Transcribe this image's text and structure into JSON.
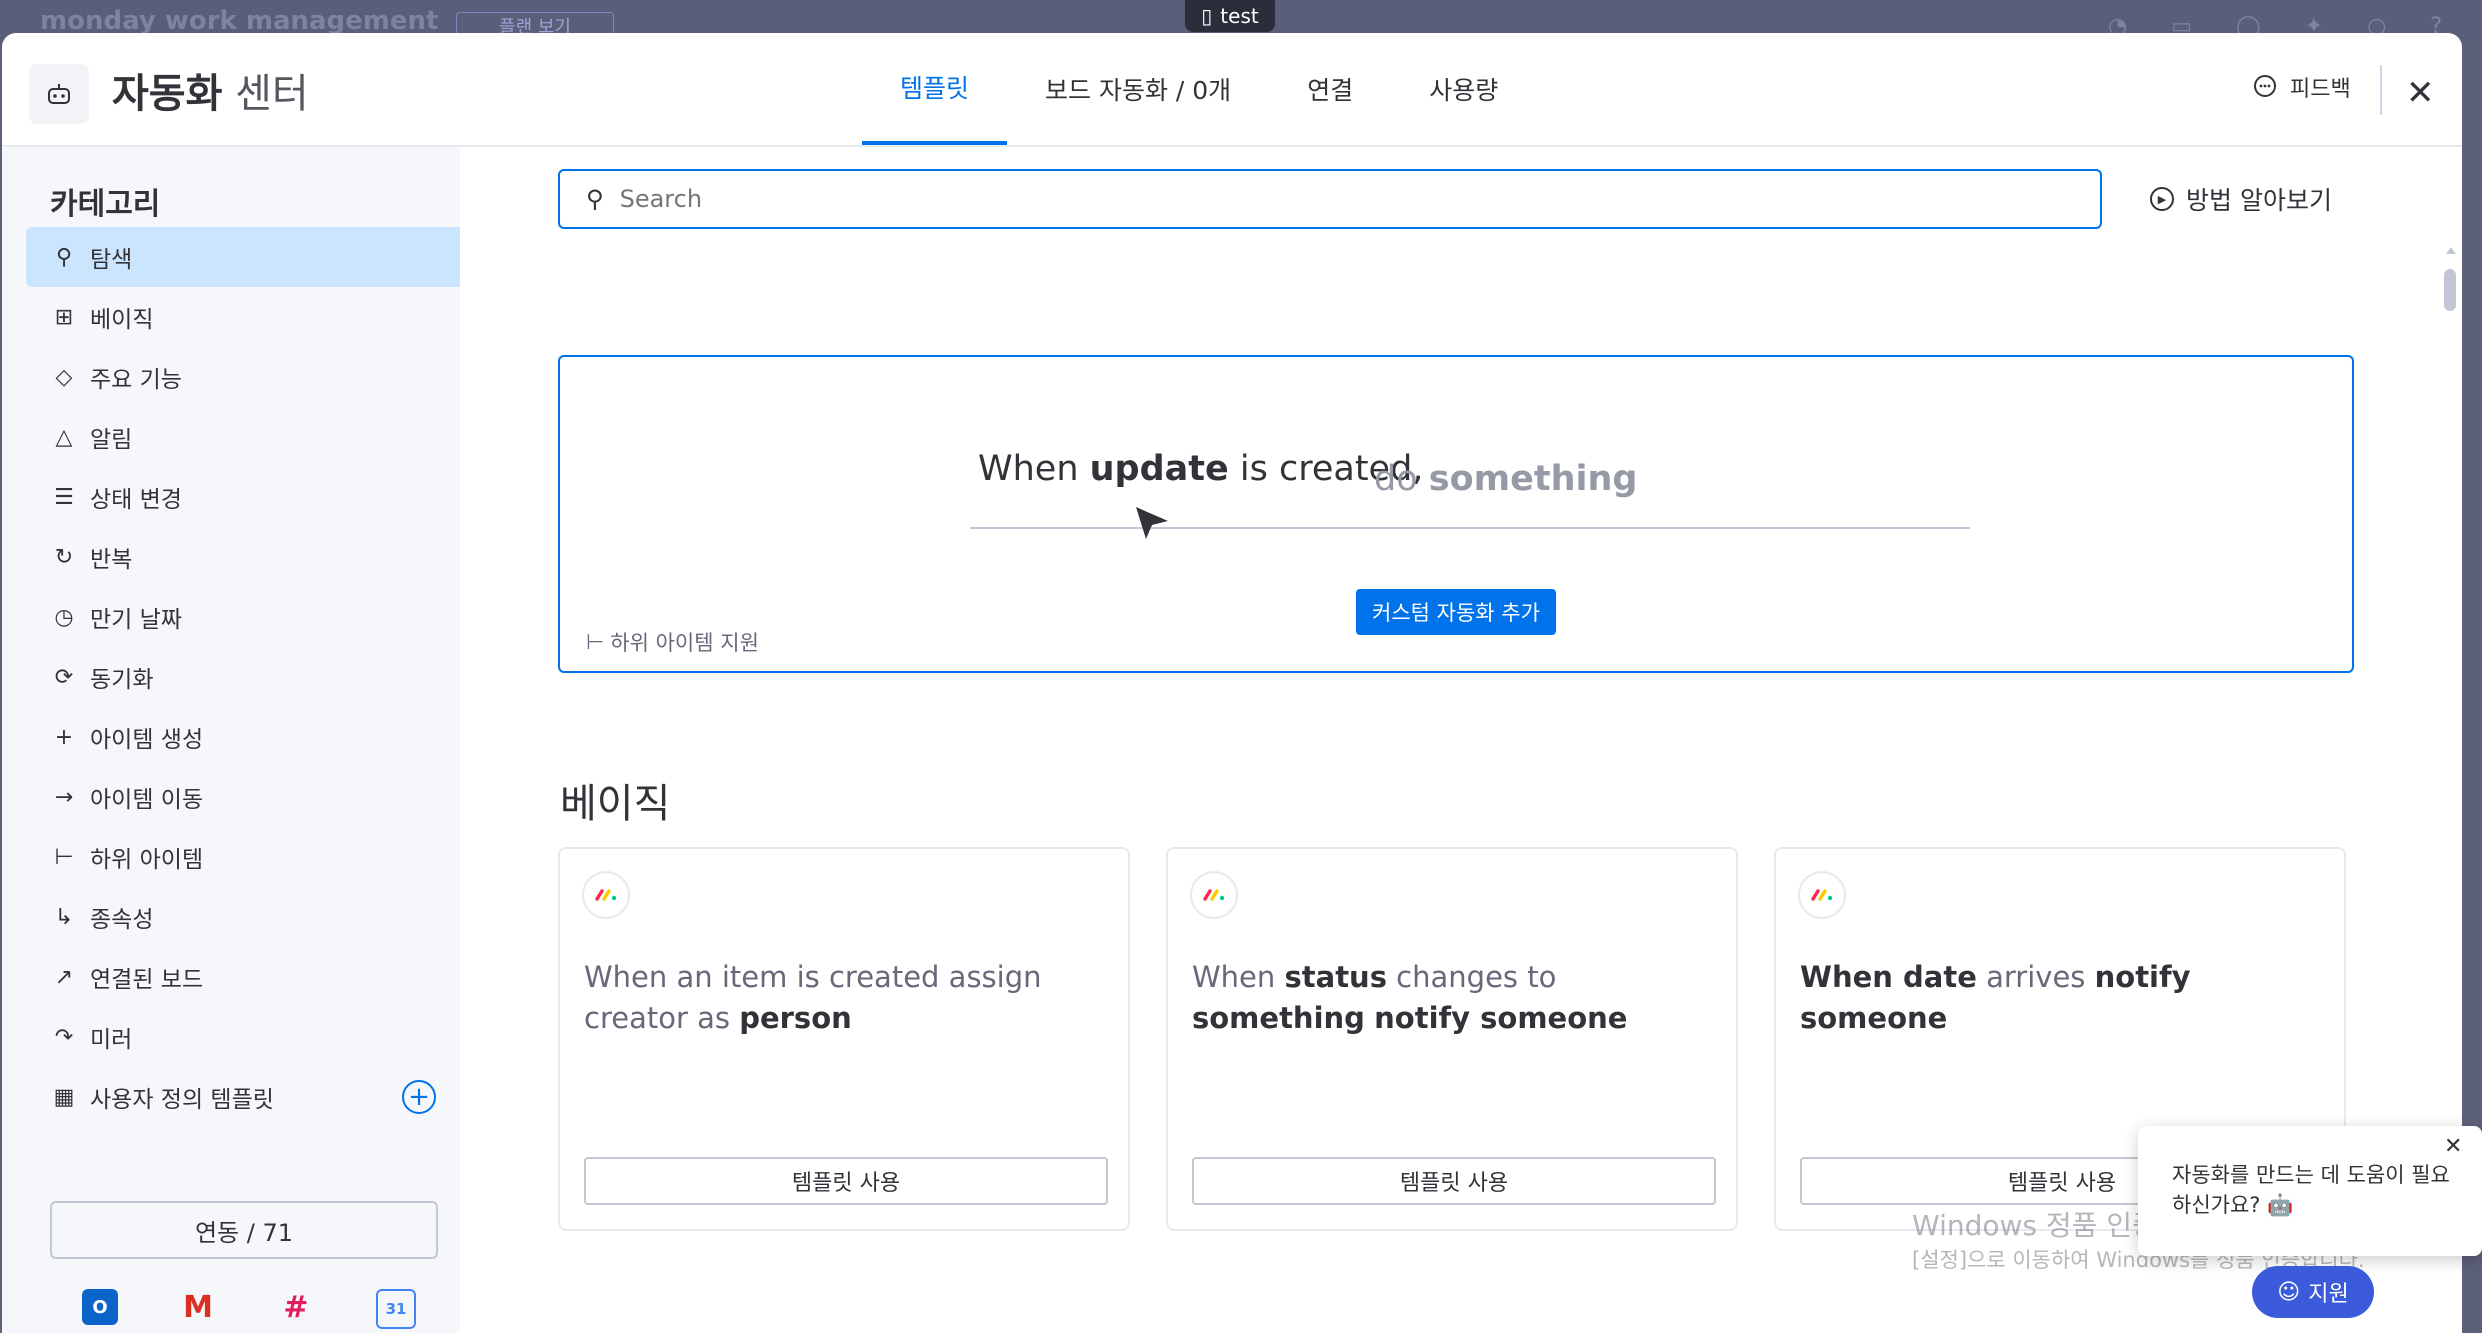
{
  "background": {
    "app_logo": "monday work management",
    "plan_button": "플랜 보기",
    "window_tab": "test"
  },
  "header": {
    "title_bold": "자동화",
    "title_light": "센터",
    "tabs": [
      {
        "label": "템플릿",
        "active": true
      },
      {
        "label": "보드 자동화 / 0개",
        "active": false
      },
      {
        "label": "연결",
        "active": false
      },
      {
        "label": "사용량",
        "active": false
      }
    ],
    "feedback_label": "피드백"
  },
  "sidebar": {
    "title": "카테고리",
    "items": [
      {
        "label": "탐색",
        "icon": "telescope-icon",
        "active": true
      },
      {
        "label": "베이직",
        "icon": "shapes-icon"
      },
      {
        "label": "주요 기능",
        "icon": "diamond-icon"
      },
      {
        "label": "알림",
        "icon": "bell-icon"
      },
      {
        "label": "상태 변경",
        "icon": "list-icon"
      },
      {
        "label": "반복",
        "icon": "recurring-icon"
      },
      {
        "label": "만기 날짜",
        "icon": "alarm-icon"
      },
      {
        "label": "동기화",
        "icon": "sync-icon"
      },
      {
        "label": "아이템 생성",
        "icon": "plus-icon"
      },
      {
        "label": "아이템 이동",
        "icon": "arrow-right-icon"
      },
      {
        "label": "하위 아이템",
        "icon": "subitem-icon"
      },
      {
        "label": "종속성",
        "icon": "dependency-icon"
      },
      {
        "label": "연결된 보드",
        "icon": "arrow-up-right-icon"
      },
      {
        "label": "미러",
        "icon": "mirror-icon"
      },
      {
        "label": "사용자 정의 템플릿",
        "icon": "building-icon"
      }
    ],
    "integrations_button": "연동 / 71"
  },
  "main": {
    "search_placeholder": "Search",
    "learn_label": "방법 알아보기",
    "hero": {
      "sentence_prefix": "When ",
      "sentence_bold": "update",
      "sentence_suffix": " is created,",
      "do_text": "do ",
      "do_bold": "something",
      "button": "커스텀 자동화 추가",
      "subitem_support": "하위 아이템 지원"
    },
    "section_title": "베이직",
    "cards": [
      {
        "part1": "When an item is created assign creator as ",
        "bold1": "person",
        "button": "템플릿 사용"
      },
      {
        "part1": "When ",
        "bold1": "status",
        "part2": " changes to ",
        "bold2": "something",
        "part3": " ",
        "bold3": "notify someone",
        "button": "템플릿 사용"
      },
      {
        "bold1": "When date",
        "part2": " arrives ",
        "bold2": "notify someone",
        "button": "템플릿 사용"
      }
    ]
  },
  "help": {
    "text": "자동화를 만드는 데 도움이 필요하신가요? 🤖",
    "support_label": "지원"
  },
  "watermark": {
    "line1": "Windows 정품 인증",
    "line2": "[설정]으로 이동하여 Windows를 정품 인증합니다."
  }
}
